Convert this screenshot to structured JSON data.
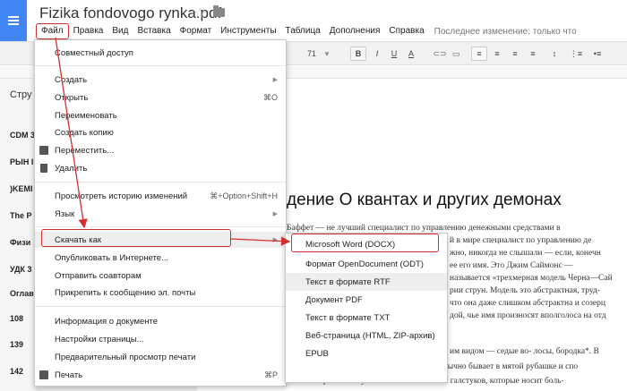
{
  "header": {
    "doc_title": "Fizika fondovogo rynka.pdf",
    "menu": [
      "Файл",
      "Правка",
      "Вид",
      "Вставка",
      "Формат",
      "Инструменты",
      "Таблица",
      "Дополнения",
      "Справка"
    ],
    "last_edit": "Последнее изменение: только что"
  },
  "toolbar": {
    "font_size": "71",
    "bold": "B",
    "italic": "I",
    "underline": "U",
    "text_color": "A"
  },
  "outline": {
    "title": "Стру",
    "items": [
      "CDM 3",
      "РЫН I",
      ")KEMI",
      "The P",
      "Физи",
      "УДК 3",
      "Оглав",
      "108",
      "139",
      "142"
    ]
  },
  "document": {
    "heading": "дение О квантах и других демонах",
    "lines": [
      "Баффет — не лучший специалист по управлению денежными средствами в",
      "й в мире специалист по управлению де",
      "жно, никогда не слышали — если, конечн",
      "ее его имя. Это Джим Саймонс —",
      "называется «трехмерная модель Черна—Сай",
      "рии струн. Модель это абстрактная, труд-",
      "что она даже слишком абстрактна и созерц",
      "дой, чье имя произносят вполголоса на отд",
      "им видом — седые во- лосы, бородка*. В",
      "когда он появляется на публике, Саймонс обычно бывает в мятой рубашке и спо",
      "— он не признает отутюженных костюмов и галстуков, которые носит боль-"
    ]
  },
  "file_menu": {
    "items": [
      {
        "label": "Совместный доступ",
        "shortcut": "",
        "submenu": false
      },
      {
        "label": "Создать",
        "shortcut": "",
        "submenu": true
      },
      {
        "label": "Открыть",
        "shortcut": "⌘O",
        "submenu": false
      },
      {
        "label": "Переименовать",
        "shortcut": "",
        "submenu": false
      },
      {
        "label": "Создать копию",
        "shortcut": "",
        "submenu": false
      },
      {
        "label": "Переместить...",
        "shortcut": "",
        "submenu": false
      },
      {
        "label": "Удалить",
        "shortcut": "",
        "submenu": false
      },
      {
        "label": "Просмотреть историю изменений",
        "shortcut": "⌘+Option+Shift+H",
        "submenu": false
      },
      {
        "label": "Язык",
        "shortcut": "",
        "submenu": true
      },
      {
        "label": "Скачать как",
        "shortcut": "",
        "submenu": true
      },
      {
        "label": "Опубликовать в Интернете...",
        "shortcut": "",
        "submenu": false
      },
      {
        "label": "Отправить соавторам",
        "shortcut": "",
        "submenu": false
      },
      {
        "label": "Прикрепить к сообщению эл. почты",
        "shortcut": "",
        "submenu": false
      },
      {
        "label": "Информация о документе",
        "shortcut": "",
        "submenu": false
      },
      {
        "label": "Настройки страницы...",
        "shortcut": "",
        "submenu": false
      },
      {
        "label": "Предварительный просмотр печати",
        "shortcut": "",
        "submenu": false
      },
      {
        "label": "Печать",
        "shortcut": "⌘P",
        "submenu": false
      }
    ]
  },
  "download_submenu": {
    "items": [
      "Microsoft Word (DOCX)",
      "Формат OpenDocument (ODT)",
      "Текст в формате RTF",
      "Документ PDF",
      "Текст в формате TXT",
      "Веб-страница (HTML, ZIP-архив)",
      "EPUB"
    ]
  },
  "colors": {
    "accent": "#4285f4",
    "highlight_red": "#d32f2f"
  }
}
